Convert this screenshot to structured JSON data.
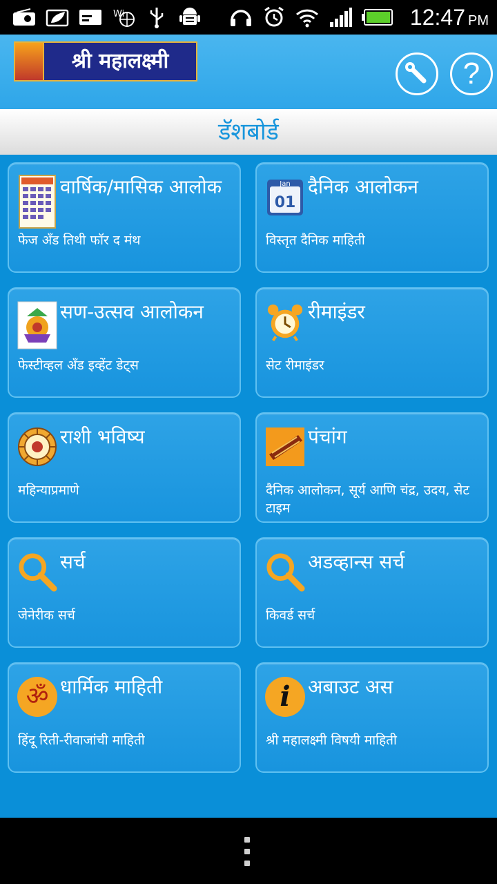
{
  "status_bar": {
    "time": "12:47",
    "ampm": "PM",
    "icons_left": [
      "radio-icon",
      "leaf-icon",
      "card-icon",
      "wifi-globe-icon",
      "usb-icon",
      "android-debug-icon"
    ],
    "icons_right": [
      "headset-icon",
      "alarm-icon",
      "wifi-icon",
      "signal-icon",
      "battery-icon"
    ]
  },
  "header": {
    "logo_text": "श्री महालक्ष्मी",
    "tools_icon": "wrench-icon",
    "help_icon": "question-icon",
    "help_glyph": "?"
  },
  "page": {
    "title": "डॅशबोर्ड"
  },
  "cards": [
    {
      "title": "वार्षिक/मासिक आलोक",
      "subtitle": "फेज अँड तिथी फॉर द मंथ",
      "icon": "calendar-grid-icon"
    },
    {
      "title": "दैनिक आलोकन",
      "subtitle": "विस्तृत दैनिक माहिती",
      "icon": "daily-calendar-icon",
      "icon_text_top": "Jan",
      "icon_text_main": "01"
    },
    {
      "title": "सण-उत्सव आलोकन",
      "subtitle": "फेस्टीव्हल अँड इव्हेंट डेट्स",
      "icon": "festival-kalash-icon"
    },
    {
      "title": "रीमाइंडर",
      "subtitle": "सेट रीमाइंडर",
      "icon": "alarm-clock-icon"
    },
    {
      "title": "राशी भविष्य",
      "subtitle": "महिन्याप्रमाणे",
      "icon": "zodiac-wheel-icon"
    },
    {
      "title": "पंचांग",
      "subtitle": "दैनिक आलोकन, सूर्य आणि चंद्र, उदय, सेट टाइम",
      "icon": "panchang-scroll-icon"
    },
    {
      "title": "सर्च",
      "subtitle": "जेनेरीक सर्च",
      "icon": "magnifier-icon"
    },
    {
      "title": "अडव्हान्स सर्च",
      "subtitle": "किवर्ड सर्च",
      "icon": "magnifier-icon"
    },
    {
      "title": "धार्मिक माहिती",
      "subtitle": "हिंदू रिती-रीवाजांची माहिती",
      "icon": "om-icon",
      "icon_glyph": "ॐ"
    },
    {
      "title": "अबाउट अस",
      "subtitle": "श्री महालक्ष्मी विषयी माहिती",
      "icon": "info-icon",
      "icon_glyph": "i"
    }
  ],
  "nav": {
    "menu_icon": "overflow-menu-icon"
  },
  "colors": {
    "background": "#0a8fd8",
    "card": "#1f9be0",
    "title_text": "#1795dc",
    "icon_orange": "#f5a623"
  }
}
